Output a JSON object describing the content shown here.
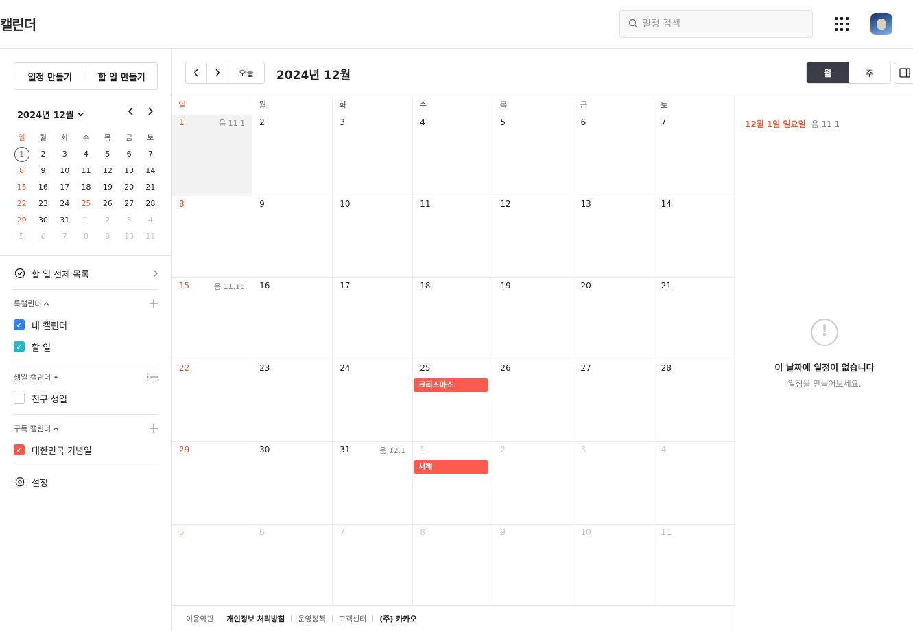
{
  "header": {
    "title": "캘린더",
    "search_placeholder": "일정 검색"
  },
  "sidebar": {
    "create_event": "일정 만들기",
    "create_todo": "할 일 만들기",
    "mini_month": "2024년 12월",
    "dow": [
      "일",
      "월",
      "화",
      "수",
      "목",
      "금",
      "토"
    ],
    "weeks": [
      [
        "1",
        "2",
        "3",
        "4",
        "5",
        "6",
        "7"
      ],
      [
        "8",
        "9",
        "10",
        "11",
        "12",
        "13",
        "14"
      ],
      [
        "15",
        "16",
        "17",
        "18",
        "19",
        "20",
        "21"
      ],
      [
        "22",
        "23",
        "24",
        "25",
        "26",
        "27",
        "28"
      ],
      [
        "29",
        "30",
        "31",
        "1",
        "2",
        "3",
        "4"
      ],
      [
        "5",
        "6",
        "7",
        "8",
        "9",
        "10",
        "11"
      ]
    ],
    "todo_all": "할 일 전체 목록",
    "talk_calendar": "톡캘린더",
    "my_calendar": "내 캘린더",
    "todo": "할 일",
    "birthday_calendar": "생일 캘린더",
    "friend_birthday": "친구 생일",
    "subscribed_calendar": "구독 캘린더",
    "korea_holidays": "대한민국 기념일",
    "settings": "설정"
  },
  "toolbar": {
    "today": "오늘",
    "month_title": "2024년 12월",
    "view_month": "월",
    "view_week": "주"
  },
  "calendar": {
    "dow": [
      "일",
      "월",
      "화",
      "수",
      "목",
      "금",
      "토"
    ],
    "weeks": [
      [
        {
          "n": "1",
          "lunar": "음 11.1"
        },
        {
          "n": "2"
        },
        {
          "n": "3"
        },
        {
          "n": "4"
        },
        {
          "n": "5"
        },
        {
          "n": "6"
        },
        {
          "n": "7"
        }
      ],
      [
        {
          "n": "8"
        },
        {
          "n": "9"
        },
        {
          "n": "10"
        },
        {
          "n": "11"
        },
        {
          "n": "12"
        },
        {
          "n": "13"
        },
        {
          "n": "14"
        }
      ],
      [
        {
          "n": "15",
          "lunar": "음 11.15"
        },
        {
          "n": "16"
        },
        {
          "n": "17"
        },
        {
          "n": "18"
        },
        {
          "n": "19"
        },
        {
          "n": "20"
        },
        {
          "n": "21"
        }
      ],
      [
        {
          "n": "22"
        },
        {
          "n": "23"
        },
        {
          "n": "24"
        },
        {
          "n": "25",
          "event": "크리스마스"
        },
        {
          "n": "26"
        },
        {
          "n": "27"
        },
        {
          "n": "28"
        }
      ],
      [
        {
          "n": "29"
        },
        {
          "n": "30"
        },
        {
          "n": "31",
          "lunar": "음 12.1"
        },
        {
          "n": "1",
          "event": "새해"
        },
        {
          "n": "2"
        },
        {
          "n": "3"
        },
        {
          "n": "4"
        }
      ],
      [
        {
          "n": "5"
        },
        {
          "n": "6"
        },
        {
          "n": "7"
        },
        {
          "n": "8"
        },
        {
          "n": "9"
        },
        {
          "n": "10"
        },
        {
          "n": "11"
        }
      ]
    ]
  },
  "panel": {
    "date": "12월 1일 일요일",
    "lunar": "음 11.1",
    "empty_title": "이 날짜에 일정이 없습니다",
    "empty_sub": "일정을 만들어보세요."
  },
  "footer": {
    "terms": "이용약관",
    "privacy": "개인정보 처리방침",
    "policy": "운영정책",
    "support": "고객센터",
    "company": "(주) 카카오"
  },
  "colors": {
    "sunday": "#e5603d",
    "event": "#ff5a4e",
    "active_view": "#3a3d45"
  }
}
